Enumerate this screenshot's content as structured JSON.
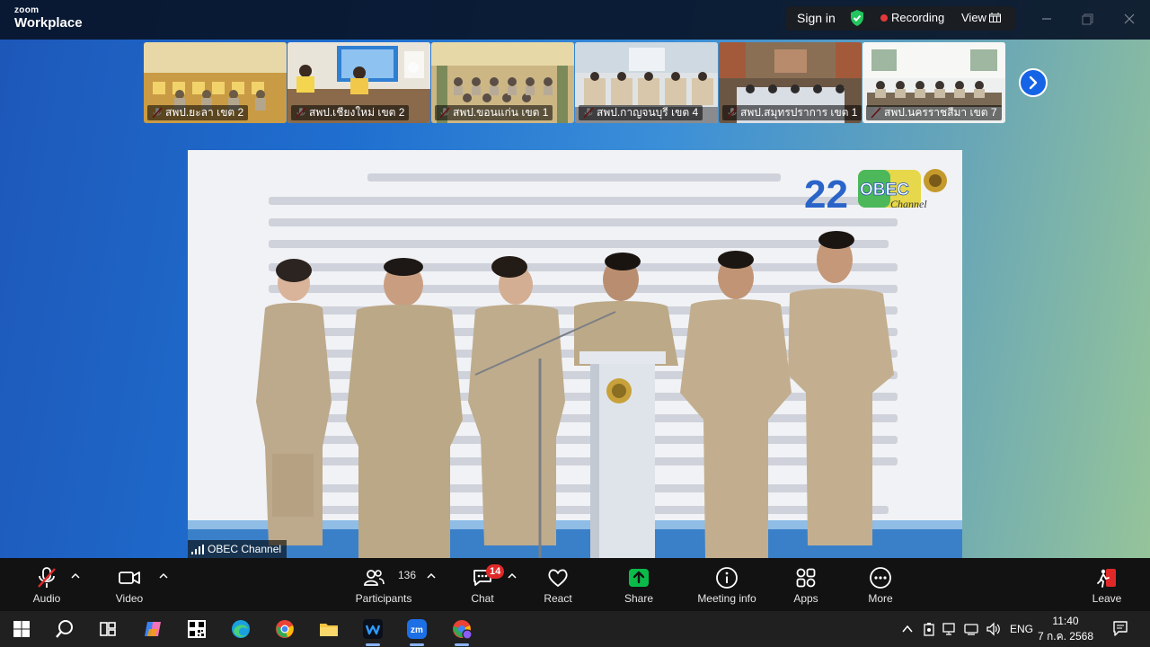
{
  "app": {
    "brand_top": "zoom",
    "brand_bottom": "Workplace",
    "sign_in": "Sign in",
    "recording": "Recording",
    "view": "View"
  },
  "participants_strip": [
    {
      "name": "สพป.ยะลา เขต 2",
      "muted": true
    },
    {
      "name": "สพป.เชียงใหม่ เขต 2",
      "muted": true
    },
    {
      "name": "สพป.ขอนแก่น เขต 1",
      "muted": true
    },
    {
      "name": "สพป.กาญจนบุรี เขต 4",
      "muted": true
    },
    {
      "name": "สพป.สมุทรปราการ เขต 1",
      "muted": true
    },
    {
      "name": "สพป.นครราชสีมา เขต 7",
      "muted": true
    }
  ],
  "video": {
    "speaker_label": "OBEC Channel",
    "logo_number": "22",
    "logo_text": "OBEC",
    "logo_sub": "Channel"
  },
  "toolbar": {
    "audio": "Audio",
    "video": "Video",
    "participants": "Participants",
    "participants_count": "136",
    "chat": "Chat",
    "chat_unread": "14",
    "react": "React",
    "share": "Share",
    "meeting_info": "Meeting info",
    "apps": "Apps",
    "more": "More",
    "leave": "Leave"
  },
  "taskbar": {
    "language": "ENG",
    "time": "11:40",
    "date": "7 ก.ค. 2568"
  },
  "colors": {
    "accent": "#1563e6",
    "share_green": "#0bbb49",
    "recording_red": "#e5383b",
    "leave_red": "#e02828"
  }
}
